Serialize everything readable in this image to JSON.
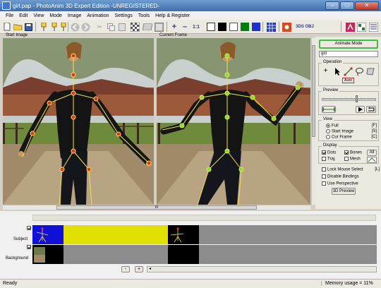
{
  "window": {
    "title": "girl.pap - PhotoAnim 3D Expert Edition -UNREGISTERED-"
  },
  "menu": [
    "File",
    "Edit",
    "View",
    "Mode",
    "Image",
    "Animation",
    "Settings",
    "Tools",
    "Help & Register"
  ],
  "toolbar": {
    "zoom_label": "1:1",
    "sds_label": "3DS OBJ",
    "swatches": [
      "#000000",
      "#ffffff",
      "#007f0e",
      "#1f2fd0"
    ]
  },
  "views": {
    "start_label": "Start Image",
    "current_label": "Current Frame",
    "scroll_mark": "III"
  },
  "panel": {
    "animate_button": "Animate Mode",
    "name_value": "girl",
    "operation_title": "Operation",
    "auto_label": "Auto",
    "preview_title": "Preview",
    "view_title": "View",
    "view_options": [
      {
        "label": "Full",
        "key": "[F]",
        "selected": true
      },
      {
        "label": "Start Image",
        "key": "[S]",
        "selected": false
      },
      {
        "label": "Cur Frame",
        "key": "[C]",
        "selected": false
      }
    ],
    "display_title": "Display",
    "display": {
      "dots": "Dots",
      "bones": "Bones",
      "all": "All",
      "traj": "Traj.",
      "mesh": "Mesh",
      "dots_checked": true,
      "bones_checked": true,
      "traj_checked": false,
      "mesh_checked": false
    },
    "lock_mouse": "Lock Mouse Select",
    "lock_key": "[L]",
    "disable_bindings": "Disable Bindings",
    "use_perspective": "Use Perspective",
    "preview3d_button": "3D Preview"
  },
  "timeline": {
    "tracks": [
      {
        "label": "Subject",
        "checked": true
      },
      {
        "label": "Background",
        "checked": true
      }
    ],
    "minus": "-",
    "plus": "+"
  },
  "status": {
    "left": "Ready",
    "right": "Memory usage = 11%"
  }
}
